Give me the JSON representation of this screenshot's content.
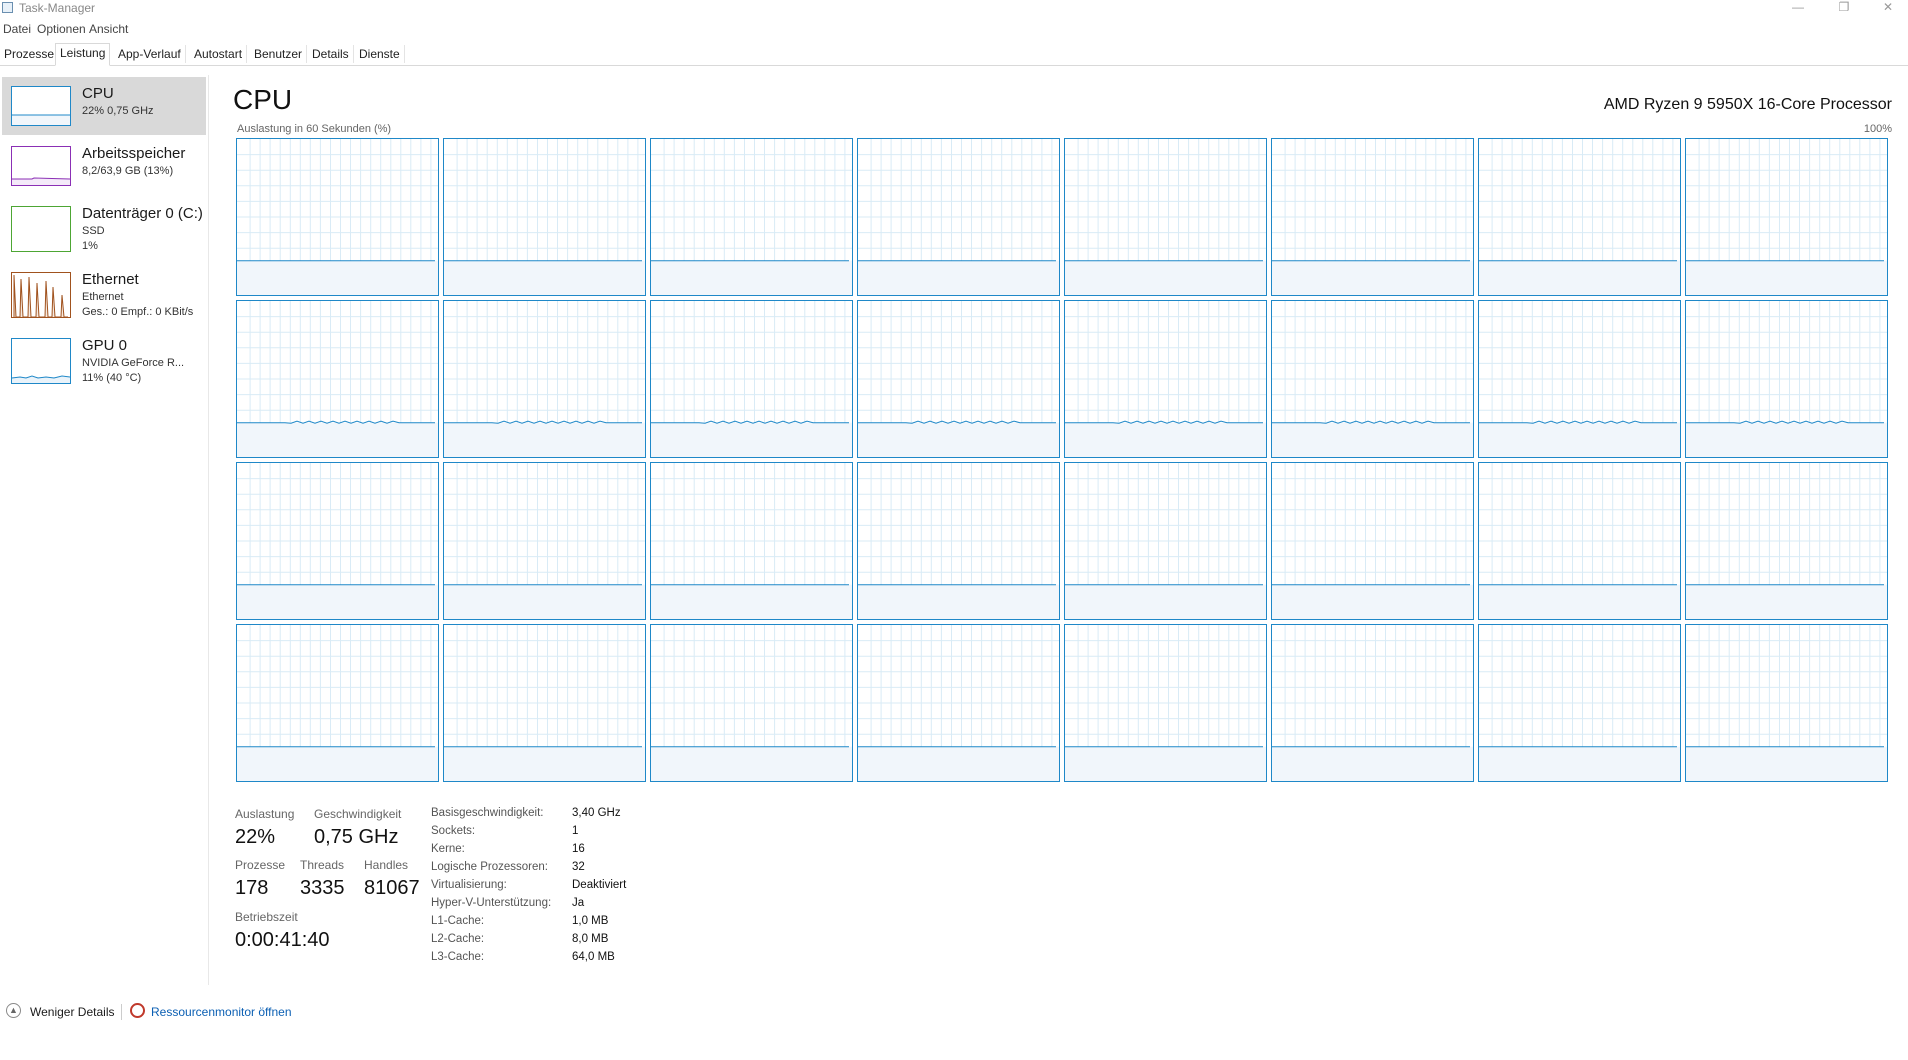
{
  "window": {
    "title": "Task-Manager",
    "minimize": "—",
    "maximize": "❐",
    "close": "✕"
  },
  "menu": [
    "Datei",
    "Optionen",
    "Ansicht"
  ],
  "tabs": [
    "Prozesse",
    "Leistung",
    "App-Verlauf",
    "Autostart",
    "Benutzer",
    "Details",
    "Dienste"
  ],
  "active_tab": "Leistung",
  "sidebar": {
    "items": [
      {
        "name": "CPU",
        "lines": [
          "22% 0,75 GHz"
        ],
        "color": "#1f88c8",
        "selected": true,
        "icon": "cpu-graph-icon"
      },
      {
        "name": "Arbeitsspeicher",
        "lines": [
          "8,2/63,9 GB (13%)"
        ],
        "color": "#8b2fb5",
        "selected": false,
        "icon": "memory-graph-icon"
      },
      {
        "name": "Datenträger 0 (C:)",
        "lines": [
          "SSD",
          "1%"
        ],
        "color": "#4da634",
        "selected": false,
        "icon": "disk-graph-icon"
      },
      {
        "name": "Ethernet",
        "lines": [
          "Ethernet",
          "Ges.: 0 Empf.: 0 KBit/s"
        ],
        "color": "#a0521e",
        "selected": false,
        "icon": "ethernet-graph-icon"
      },
      {
        "name": "GPU 0",
        "lines": [
          "NVIDIA GeForce R...",
          "11% (40 °C)"
        ],
        "color": "#1f88c8",
        "selected": false,
        "icon": "gpu-graph-icon"
      }
    ]
  },
  "main": {
    "title": "CPU",
    "processor": "AMD Ryzen 9 5950X 16-Core Processor",
    "graph_label": "Auslastung in 60 Sekunden (%)",
    "graph_max": "100%",
    "logical_processor_count": 32,
    "graph_color": "#1f88c8"
  },
  "stats": {
    "auslastung": {
      "label": "Auslastung",
      "value": "22%"
    },
    "geschwindigkeit": {
      "label": "Geschwindigkeit",
      "value": "0,75 GHz"
    },
    "prozesse": {
      "label": "Prozesse",
      "value": "178"
    },
    "threads": {
      "label": "Threads",
      "value": "3335"
    },
    "handles": {
      "label": "Handles",
      "value": "81067"
    },
    "betriebszeit": {
      "label": "Betriebszeit",
      "value": "0:00:41:40"
    }
  },
  "info": [
    {
      "key": "Basisgeschwindigkeit:",
      "value": "3,40 GHz"
    },
    {
      "key": "Sockets:",
      "value": "1"
    },
    {
      "key": "Kerne:",
      "value": "16"
    },
    {
      "key": "Logische Prozessoren:",
      "value": "32"
    },
    {
      "key": "Virtualisierung:",
      "value": "Deaktiviert"
    },
    {
      "key": "Hyper-V-Unterstützung:",
      "value": "Ja"
    },
    {
      "key": "L1-Cache:",
      "value": "1,0 MB"
    },
    {
      "key": "L2-Cache:",
      "value": "8,0 MB"
    },
    {
      "key": "L3-Cache:",
      "value": "64,0 MB"
    }
  ],
  "footer": {
    "fewer_details": "Weniger Details",
    "resource_monitor": "Ressourcenmonitor öffnen"
  }
}
